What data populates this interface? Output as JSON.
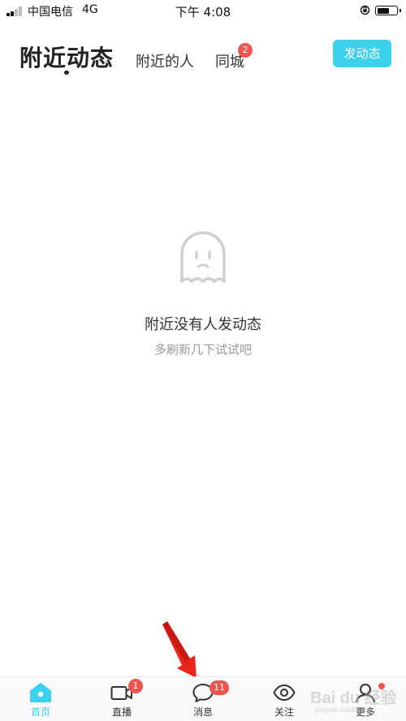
{
  "status_bar": {
    "carrier": "中国电信",
    "network": "4G",
    "time": "下午 4:08"
  },
  "header": {
    "active_tab": "附近动态",
    "tabs": [
      {
        "label": "附近的人"
      },
      {
        "label": "同城",
        "badge": "2"
      }
    ],
    "post_button": "发动态"
  },
  "empty_state": {
    "icon": "ghost-icon",
    "title": "附近没有人发动态",
    "subtitle": "多刷新几下试试吧"
  },
  "tab_bar": {
    "items": [
      {
        "label": "首页",
        "icon": "home-icon",
        "active": true
      },
      {
        "label": "直播",
        "icon": "video-icon",
        "badge": "1"
      },
      {
        "label": "消息",
        "icon": "chat-bubble-icon",
        "badge": "11"
      },
      {
        "label": "关注",
        "icon": "eye-icon"
      },
      {
        "label": "更多",
        "icon": "person-icon",
        "dot_badge": true
      }
    ]
  },
  "colors": {
    "accent": "#3bd1ec",
    "badge": "#f0544f",
    "arrow": "#e8261c"
  },
  "watermark": {
    "text": "Bai du 经验",
    "url": "jingyan.baidu.com"
  }
}
